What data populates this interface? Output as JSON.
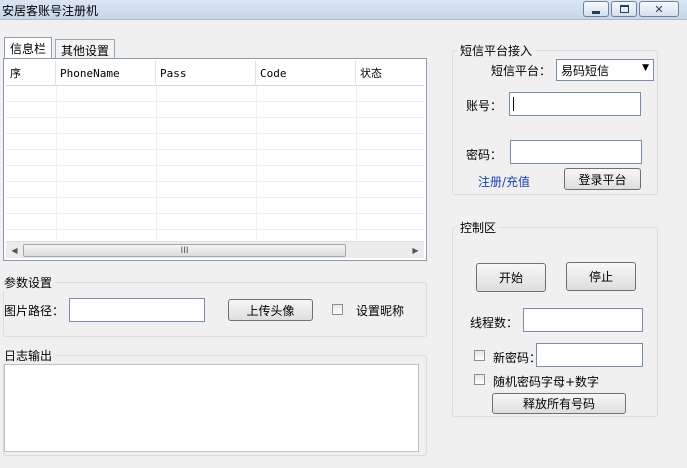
{
  "window": {
    "title": "安居客账号注册机"
  },
  "tabs": [
    {
      "label": "信息栏"
    },
    {
      "label": "其他设置"
    }
  ],
  "grid": {
    "columns": [
      "序",
      "PhoneName",
      "Pass",
      "Code",
      "状态"
    ],
    "scroll_thumb_text": "III"
  },
  "params": {
    "group_title": "参数设置",
    "image_path_label": "图片路径：",
    "image_path_value": "",
    "upload_button": "上传头像",
    "nickname_checkbox_label": "设置昵称"
  },
  "log": {
    "group_title": "日志输出",
    "content": ""
  },
  "sms": {
    "group_title": "短信平台接入",
    "platform_label": "短信平台：",
    "platform_selected": "易码短信",
    "account_label": "账号：",
    "account_value": "",
    "password_label": "密码：",
    "password_value": "",
    "register_link": "注册/充值",
    "login_button": "登录平台"
  },
  "control": {
    "group_title": "控制区",
    "start_button": "开始",
    "stop_button": "停止",
    "threads_label": "线程数：",
    "threads_value": "",
    "new_password_label": "新密码：",
    "new_password_value": "",
    "random_password_label": "随机密码字母+数字",
    "release_button": "释放所有号码"
  }
}
